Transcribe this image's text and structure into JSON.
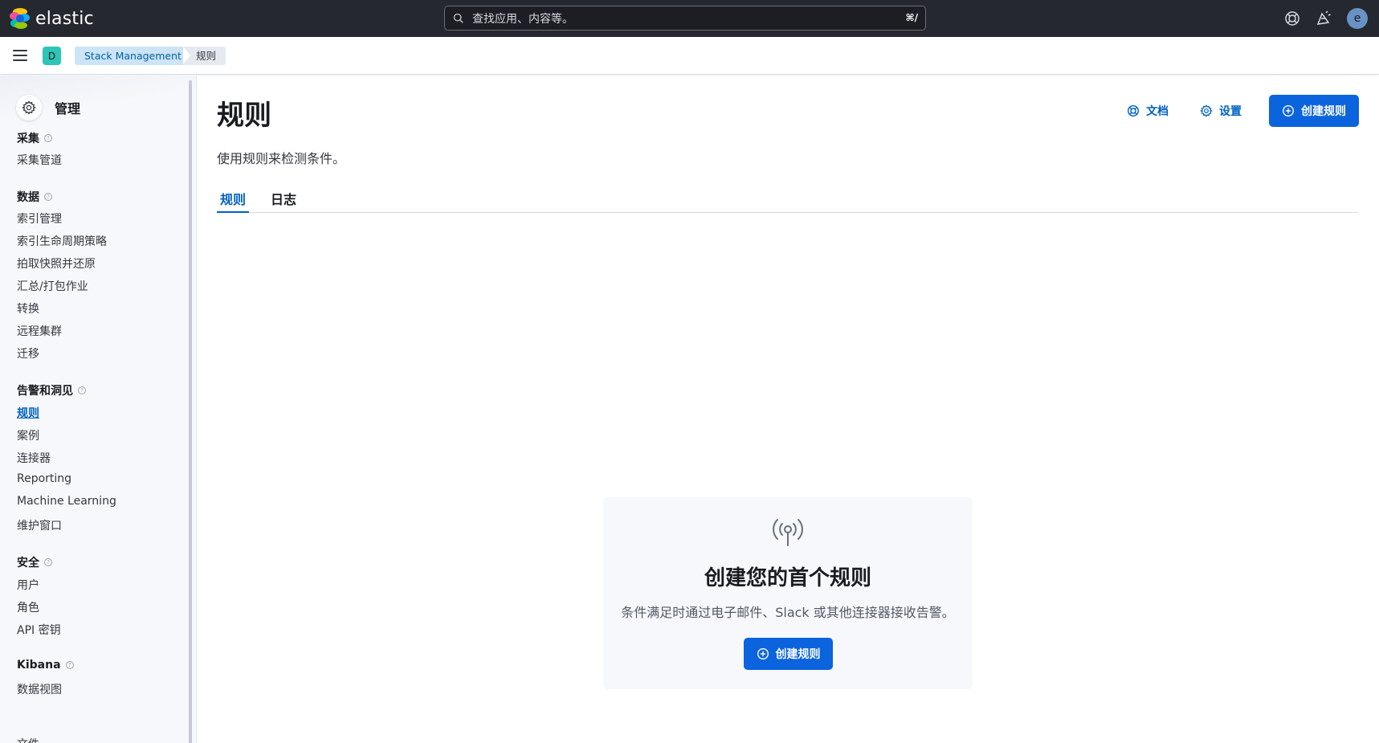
{
  "header": {
    "brand": "elastic",
    "search_placeholder": "查找应用、内容等。",
    "search_shortcut": "⌘/",
    "help_icon": "help-lifebuoy-icon",
    "news_icon": "newsfeed-icon",
    "user_initial": "e"
  },
  "breadcrumbs": {
    "space_initial": "D",
    "items": [
      "Stack Management",
      "规则"
    ]
  },
  "sidebar": {
    "title": "管理",
    "groups": [
      {
        "label": "采集",
        "items": [
          "采集管道"
        ]
      },
      {
        "label": "数据",
        "items": [
          "索引管理",
          "索引生命周期策略",
          "拍取快照并还原",
          "汇总/打包作业",
          "转换",
          "远程集群",
          "迁移"
        ]
      },
      {
        "label": "告警和洞见",
        "items": [
          "规则",
          "案例",
          "连接器",
          "Reporting",
          "Machine Learning",
          "维护窗口"
        ]
      },
      {
        "label": "安全",
        "items": [
          "用户",
          "角色",
          "API 密钥"
        ]
      },
      {
        "label": "Kibana",
        "items": [
          "数据视图",
          "文件"
        ]
      }
    ],
    "active_item": "规则"
  },
  "page": {
    "title": "规则",
    "description": "使用规则来检测条件。",
    "docs_label": "文档",
    "settings_label": "设置",
    "create_label": "创建规则",
    "tabs": [
      "规则",
      "日志"
    ],
    "active_tab": "规则"
  },
  "empty_state": {
    "icon": "broadcast-antenna-icon",
    "title": "创建您的首个规则",
    "body": "条件满足时通过电子邮件、Slack 或其他连接器接收告警。",
    "button_label": "创建规则"
  },
  "colors": {
    "accent": "#0b64dd",
    "header_bg": "#25282f",
    "sidebar_bg": "#f7f8fc"
  }
}
